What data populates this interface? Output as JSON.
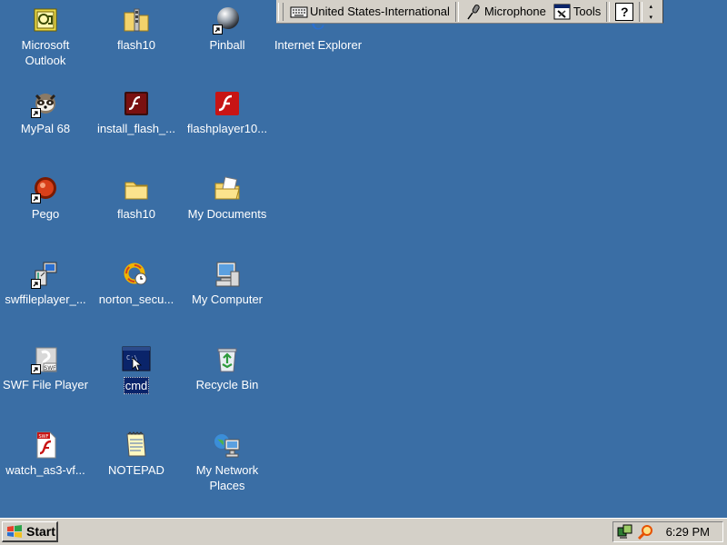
{
  "desktop": {
    "icons": [
      {
        "label": "Microsoft Outlook"
      },
      {
        "label": "flash10"
      },
      {
        "label": "Pinball"
      },
      {
        "label": "Internet Explorer"
      },
      {
        "label": "MyPal 68"
      },
      {
        "label": "install_flash_..."
      },
      {
        "label": "flashplayer10..."
      },
      {
        "label": "Pego"
      },
      {
        "label": "flash10"
      },
      {
        "label": "My Documents"
      },
      {
        "label": "swffileplayer_..."
      },
      {
        "label": "norton_secu..."
      },
      {
        "label": "My Computer"
      },
      {
        "label": "SWF File Player"
      },
      {
        "label": "cmd"
      },
      {
        "label": "Recycle Bin"
      },
      {
        "label": "watch_as3-vf..."
      },
      {
        "label": "NOTEPAD"
      },
      {
        "label": "My Network Places"
      }
    ],
    "background_color": "#3a6ea5",
    "selected_icon": "cmd"
  },
  "language_bar": {
    "language": "United States-International",
    "microphone": "Microphone",
    "tools": "Tools",
    "help": "?"
  },
  "taskbar": {
    "start_label": "Start",
    "clock": "6:29 PM"
  }
}
